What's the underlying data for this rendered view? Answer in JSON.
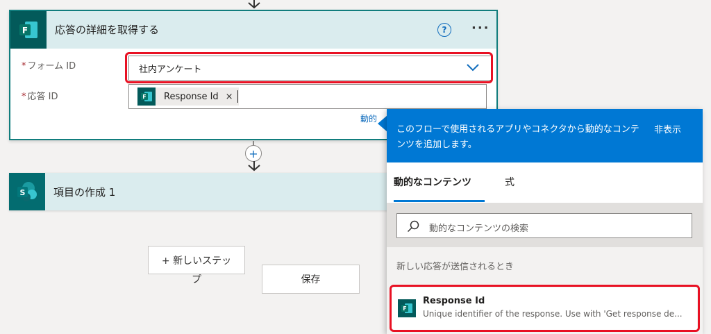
{
  "colors": {
    "forms_teal": "#035a5a",
    "sharepoint_teal": "#036c70",
    "header_bg": "#daecee",
    "accent_blue": "#0078d4",
    "highlight_red": "#e81123"
  },
  "action_card": {
    "title": "応答の詳細を取得する",
    "icon": "forms-icon",
    "icon_letter": "F",
    "help_label": "?",
    "more_label": "···",
    "form_id": {
      "required_mark": "*",
      "label": "フォーム ID",
      "value": "社内アンケート"
    },
    "response_id": {
      "required_mark": "*",
      "label": "応答 ID",
      "token_label": "Response Id",
      "token_remove": "×"
    },
    "dynamic_link": "動的"
  },
  "connector": {
    "plus_label": "+"
  },
  "second_card": {
    "title": "項目の作成 1",
    "icon": "sharepoint-icon",
    "icon_letter": "S"
  },
  "buttons": {
    "new_step_line1": "+ 新しいステッ",
    "new_step_line2": "プ",
    "save": "保存"
  },
  "dynamic_panel": {
    "header_text": "このフローで使用されるアプリやコネクタから動的なコンテンツを追加します。",
    "hide_label": "非表示",
    "tabs": [
      {
        "label": "動的なコンテンツ",
        "active": true
      },
      {
        "label": "式",
        "active": false
      }
    ],
    "search_placeholder": "動的なコンテンツの検索",
    "section_title": "新しい応答が送信されるとき",
    "items": [
      {
        "title": "Response Id",
        "description": "Unique identifier of the response. Use with 'Get response de...",
        "icon": "forms-icon"
      }
    ]
  }
}
